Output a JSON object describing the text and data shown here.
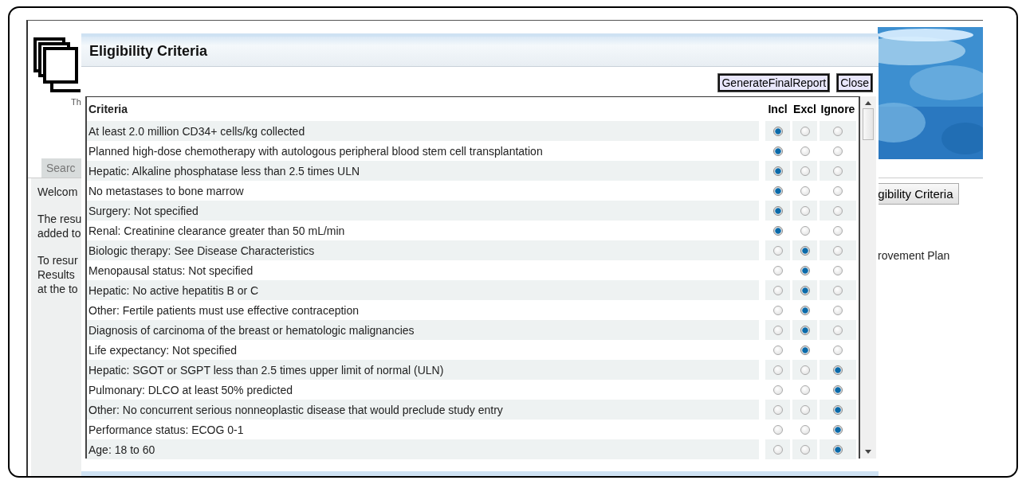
{
  "page": {
    "logo_caption": "Th",
    "search_tab": "Searc",
    "panel_texts": [
      "Welcom",
      "The resu\nadded to",
      "To resur\nResults\nat the to"
    ],
    "criteria_button": "igibility Criteria",
    "right_text": "rovement Plan"
  },
  "dialog": {
    "title": "Eligibility Criteria",
    "buttons": [
      "GenerateFinalReport",
      "Close"
    ],
    "columns": [
      "Criteria",
      "Incl",
      "Excl",
      "Ignore"
    ],
    "rows": [
      {
        "criterion": "At least 2.0 million CD34+ cells/kg collected",
        "options": [
          {
            "selected": true
          },
          {
            "selected": false
          },
          {
            "selected": false
          }
        ]
      },
      {
        "criterion": "Planned high-dose chemotherapy with autologous peripheral blood stem cell transplantation",
        "options": [
          {
            "selected": true
          },
          {
            "selected": false
          },
          {
            "selected": false
          }
        ]
      },
      {
        "criterion": "Hepatic: Alkaline phosphatase less than 2.5 times ULN",
        "options": [
          {
            "selected": true
          },
          {
            "selected": false
          },
          {
            "selected": false
          }
        ]
      },
      {
        "criterion": "No metastases to bone marrow",
        "options": [
          {
            "selected": true
          },
          {
            "selected": false
          },
          {
            "selected": false
          }
        ]
      },
      {
        "criterion": "Surgery: Not specified",
        "options": [
          {
            "selected": true
          },
          {
            "selected": false
          },
          {
            "selected": false
          }
        ]
      },
      {
        "criterion": "Renal: Creatinine clearance greater than 50 mL/min",
        "options": [
          {
            "selected": true
          },
          {
            "selected": false
          },
          {
            "selected": false
          }
        ]
      },
      {
        "criterion": "Biologic therapy: See Disease Characteristics",
        "options": [
          {
            "selected": false
          },
          {
            "selected": true
          },
          {
            "selected": false
          }
        ]
      },
      {
        "criterion": "Menopausal status: Not specified",
        "options": [
          {
            "selected": false
          },
          {
            "selected": true
          },
          {
            "selected": false
          }
        ]
      },
      {
        "criterion": "Hepatic: No active hepatitis B or C",
        "options": [
          {
            "selected": false
          },
          {
            "selected": true
          },
          {
            "selected": false
          }
        ]
      },
      {
        "criterion": "Other: Fertile patients must use effective contraception",
        "options": [
          {
            "selected": false
          },
          {
            "selected": true
          },
          {
            "selected": false
          }
        ]
      },
      {
        "criterion": "Diagnosis of carcinoma of the breast or hematologic malignancies",
        "options": [
          {
            "selected": false
          },
          {
            "selected": true
          },
          {
            "selected": false
          }
        ]
      },
      {
        "criterion": "Life expectancy: Not specified",
        "options": [
          {
            "selected": false
          },
          {
            "selected": true
          },
          {
            "selected": false
          }
        ]
      },
      {
        "criterion": "Hepatic: SGOT or SGPT less than 2.5 times upper limit of normal (ULN)",
        "options": [
          {
            "selected": false
          },
          {
            "selected": false
          },
          {
            "selected": true
          }
        ]
      },
      {
        "criterion": "Pulmonary: DLCO at least 50% predicted",
        "options": [
          {
            "selected": false
          },
          {
            "selected": false
          },
          {
            "selected": true
          }
        ]
      },
      {
        "criterion": "Other: No concurrent serious nonneoplastic disease that would preclude study entry",
        "options": [
          {
            "selected": false
          },
          {
            "selected": false
          },
          {
            "selected": true
          }
        ]
      },
      {
        "criterion": "Performance status: ECOG 0-1",
        "options": [
          {
            "selected": false
          },
          {
            "selected": false
          },
          {
            "selected": true
          }
        ]
      },
      {
        "criterion": "Age: 18 to 60",
        "options": [
          {
            "selected": false
          },
          {
            "selected": false
          },
          {
            "selected": true
          }
        ]
      }
    ]
  }
}
